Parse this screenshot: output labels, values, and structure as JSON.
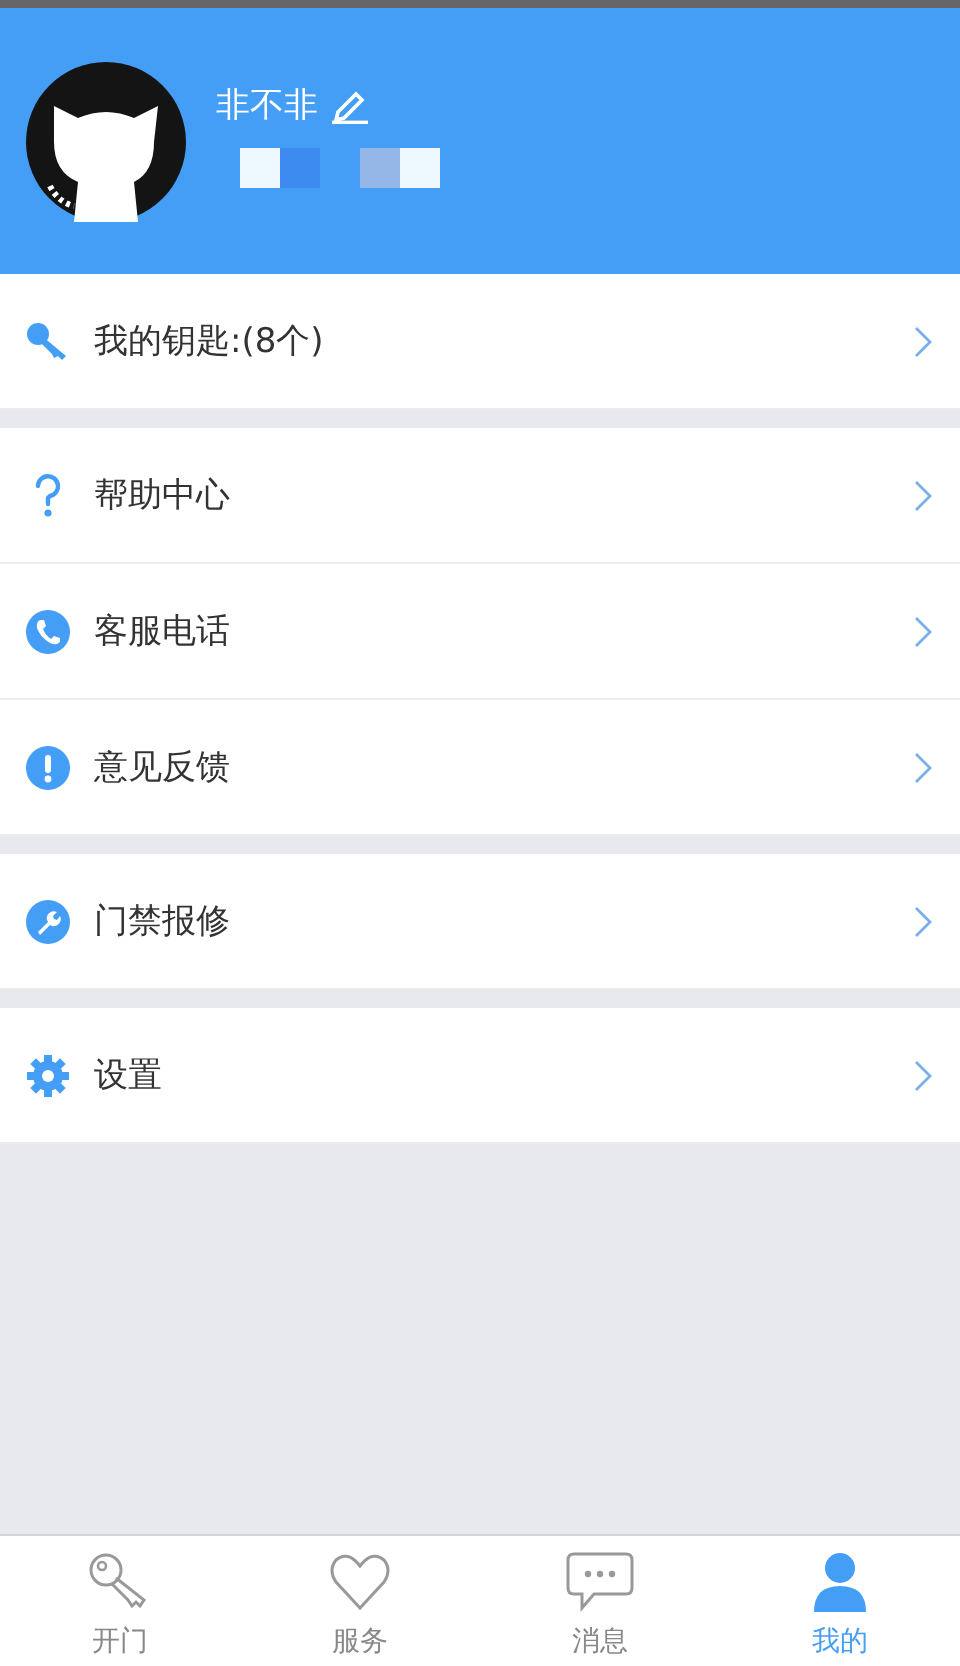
{
  "profile": {
    "name": "非不非"
  },
  "menu_groups": [
    {
      "items": [
        {
          "kind": "key",
          "label": "我的钥匙:(8个)"
        }
      ]
    },
    {
      "items": [
        {
          "kind": "help",
          "label": "帮助中心"
        },
        {
          "kind": "phone",
          "label": "客服电话"
        },
        {
          "kind": "feedback",
          "label": "意见反馈"
        }
      ]
    },
    {
      "items": [
        {
          "kind": "repair",
          "label": "门禁报修"
        }
      ]
    },
    {
      "items": [
        {
          "kind": "settings",
          "label": "设置"
        }
      ]
    }
  ],
  "tab_bar": [
    {
      "kind": "key",
      "label": "开门",
      "selected": false
    },
    {
      "kind": "heart",
      "label": "服务",
      "selected": false
    },
    {
      "kind": "chat",
      "label": "消息",
      "selected": false
    },
    {
      "kind": "person",
      "label": "我的",
      "selected": true
    }
  ]
}
